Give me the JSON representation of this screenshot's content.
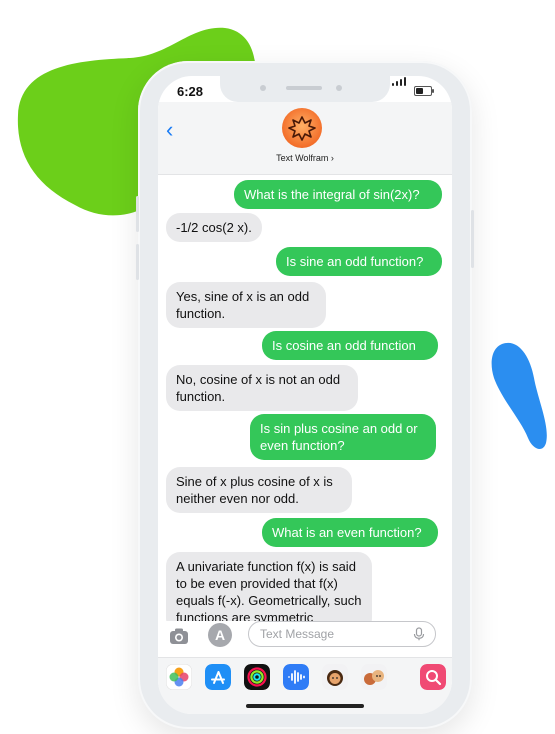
{
  "status_bar": {
    "time": "6:28"
  },
  "header": {
    "back_icon": "‹",
    "contact_name": "Text Wolfram ›"
  },
  "messages": [
    {
      "from": "me",
      "text": "What is the integral of sin(2x)?"
    },
    {
      "from": "them",
      "text": "-1/2 cos(2 x)."
    },
    {
      "from": "me",
      "text": "Is sine an odd function?"
    },
    {
      "from": "them",
      "text": "Yes, sine of x is an odd function."
    },
    {
      "from": "me",
      "text": "Is cosine an odd function"
    },
    {
      "from": "them",
      "text": "No, cosine of x is not an odd function."
    },
    {
      "from": "me",
      "text": "Is sin plus cosine an odd or even function?"
    },
    {
      "from": "them",
      "text": "Sine of x plus cosine of x is neither even nor odd."
    },
    {
      "from": "me",
      "text": "What is an even function?"
    },
    {
      "from": "them",
      "text": "A univariate function f(x) is said to be even provided that f(x) equals f(-x). Geometrically, such functions are symmetric"
    }
  ],
  "composer": {
    "placeholder": "Text Message",
    "apps_icon": "A"
  },
  "colors": {
    "outgoing_bubble": "#34c759",
    "incoming_bubble": "#e9e9eb",
    "accent_blue": "#1a7cf5",
    "blob_green": "#6ccf1a",
    "blob_blue": "#2b8ef0"
  },
  "dock_apps": [
    "photos-icon",
    "app-store-icon",
    "activity-icon",
    "audio-icon",
    "memoji-icon",
    "memoji-stickers-icon",
    "search-icon"
  ]
}
